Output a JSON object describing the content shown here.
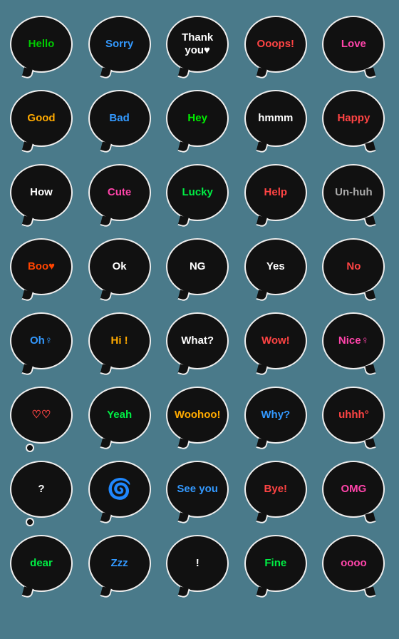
{
  "bubbles": [
    {
      "text": "Hello",
      "color": "#00cc00",
      "style": "normal"
    },
    {
      "text": "Sorry",
      "color": "#3399ff",
      "style": "normal"
    },
    {
      "text": "Thank you♥",
      "color": "#ffffff",
      "style": "normal"
    },
    {
      "text": "Ooops!",
      "color": "#ff4444",
      "style": "normal"
    },
    {
      "text": "Love",
      "color": "#ff44aa",
      "style": "right"
    },
    {
      "text": "Good",
      "color": "#ffaa00",
      "style": "normal"
    },
    {
      "text": "Bad",
      "color": "#3399ff",
      "style": "normal"
    },
    {
      "text": "Hey",
      "color": "#00ee00",
      "style": "normal"
    },
    {
      "text": "hmmm",
      "color": "#ffffff",
      "style": "normal"
    },
    {
      "text": "Happy",
      "color": "#ff4444",
      "style": "right"
    },
    {
      "text": "How",
      "color": "#ffffff",
      "style": "normal"
    },
    {
      "text": "Cute",
      "color": "#ff44aa",
      "style": "normal"
    },
    {
      "text": "Lucky",
      "color": "#00ee44",
      "style": "normal"
    },
    {
      "text": "Help",
      "color": "#ff4444",
      "style": "normal"
    },
    {
      "text": "Un-huh",
      "color": "#aaaaaa",
      "style": "right"
    },
    {
      "text": "Boo♥",
      "color": "#ff4400",
      "style": "normal"
    },
    {
      "text": "Ok",
      "color": "#ffffff",
      "style": "normal"
    },
    {
      "text": "NG",
      "color": "#ffffff",
      "style": "normal"
    },
    {
      "text": "Yes",
      "color": "#ffffff",
      "style": "normal"
    },
    {
      "text": "No",
      "color": "#ff4444",
      "style": "right"
    },
    {
      "text": "Oh♀",
      "color": "#3399ff",
      "style": "normal"
    },
    {
      "text": "Hi !",
      "color": "#ffaa00",
      "style": "normal"
    },
    {
      "text": "What?",
      "color": "#ffffff",
      "style": "normal"
    },
    {
      "text": "Wow!",
      "color": "#ff4444",
      "style": "normal"
    },
    {
      "text": "Nice♀",
      "color": "#ff44aa",
      "style": "right"
    },
    {
      "text": "♡♡",
      "color": "#ff4444",
      "style": "thought"
    },
    {
      "text": "Yeah",
      "color": "#00ee44",
      "style": "normal"
    },
    {
      "text": "Woohoo!",
      "color": "#ffaa00",
      "style": "normal"
    },
    {
      "text": "Why?",
      "color": "#3399ff",
      "style": "normal"
    },
    {
      "text": "uhhh°",
      "color": "#ff4444",
      "style": "right"
    },
    {
      "text": "?",
      "color": "#ffffff",
      "style": "thought"
    },
    {
      "text": "~",
      "color": "#aaaaaa",
      "style": "normal"
    },
    {
      "text": "See you",
      "color": "#3399ff",
      "style": "normal"
    },
    {
      "text": "Bye!",
      "color": "#ff4444",
      "style": "normal"
    },
    {
      "text": "OMG",
      "color": "#ff44aa",
      "style": "right"
    },
    {
      "text": "dear",
      "color": "#00ee44",
      "style": "normal"
    },
    {
      "text": "Zzz",
      "color": "#3399ff",
      "style": "normal"
    },
    {
      "text": "!",
      "color": "#ffffff",
      "style": "normal"
    },
    {
      "text": "Fine",
      "color": "#00ee44",
      "style": "normal"
    },
    {
      "text": "oooo",
      "color": "#ff44aa",
      "style": "right"
    }
  ]
}
